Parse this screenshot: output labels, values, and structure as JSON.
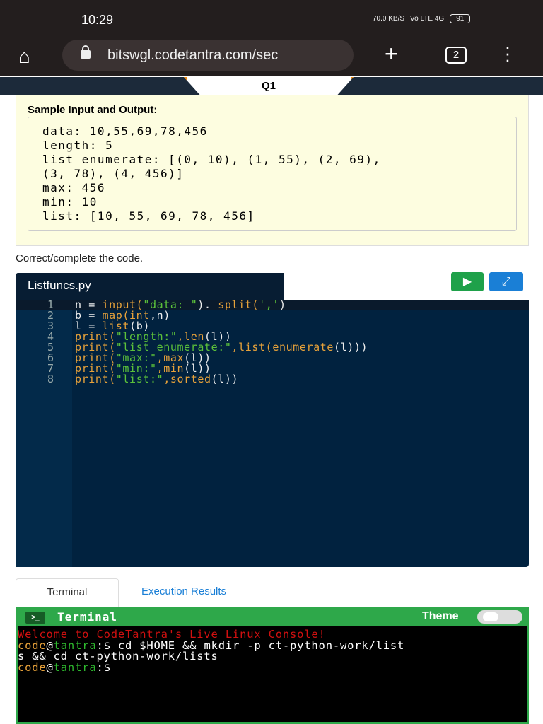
{
  "status": {
    "time": "10:29",
    "speed": "70.0 KB/S",
    "network": "Vo LTE 4G",
    "battery": "91"
  },
  "browser": {
    "url": "bitswgl.codetantra.com/sec",
    "tab_count": "2"
  },
  "question": {
    "label": "Q1"
  },
  "sample": {
    "title": "Sample Input and Output:",
    "lines": [
      "data: 10,55,69,78,456",
      "length: 5",
      "list enumerate: [(0, 10), (1, 55), (2, 69),",
      "(3, 78), (4, 456)]",
      "max: 456",
      "min: 10",
      "list: [10, 55, 69, 78, 456]"
    ]
  },
  "instruction": "Correct/complete the code.",
  "editor": {
    "filename": "Listfuncs.py",
    "run_icon": "▶",
    "expand_icon": "⤢",
    "lines": [
      {
        "n": "1",
        "parts": [
          [
            "",
            "n = "
          ],
          [
            "k",
            "input("
          ],
          [
            "s",
            "\"data: \""
          ],
          [
            "",
            "). "
          ],
          [
            "k",
            "split("
          ],
          [
            "s",
            "','"
          ],
          [
            "",
            ")"
          ]
        ]
      },
      {
        "n": "2",
        "parts": [
          [
            "",
            "b = "
          ],
          [
            "k",
            "map(int"
          ],
          [
            "",
            ",n)"
          ]
        ]
      },
      {
        "n": "3",
        "parts": [
          [
            "",
            "l = "
          ],
          [
            "k",
            "list"
          ],
          [
            "",
            "(b)"
          ]
        ]
      },
      {
        "n": "4",
        "parts": [
          [
            "k",
            "print("
          ],
          [
            "s",
            "\"length:\""
          ],
          [
            "k",
            ",len"
          ],
          [
            "",
            "(l))"
          ]
        ]
      },
      {
        "n": "5",
        "parts": [
          [
            "k",
            "print("
          ],
          [
            "s",
            "\"list enumerate:\""
          ],
          [
            "k",
            ",list(enumerate"
          ],
          [
            "",
            "(l)))"
          ]
        ]
      },
      {
        "n": "6",
        "parts": [
          [
            "k",
            "print("
          ],
          [
            "s",
            "\"max:\""
          ],
          [
            "k",
            ",max"
          ],
          [
            "",
            "(l))"
          ]
        ]
      },
      {
        "n": "7",
        "parts": [
          [
            "k",
            "print("
          ],
          [
            "s",
            "\"min:\""
          ],
          [
            "k",
            ",min"
          ],
          [
            "",
            "(l))"
          ]
        ]
      },
      {
        "n": "8",
        "parts": [
          [
            "k",
            "print("
          ],
          [
            "s",
            "\"list:\""
          ],
          [
            "k",
            ",sorted"
          ],
          [
            "",
            "(l))"
          ]
        ]
      }
    ]
  },
  "tabs": {
    "terminal": "Terminal",
    "results": "Execution Results"
  },
  "terminal": {
    "title": "Terminal",
    "theme_label": "Theme",
    "welcome": "Welcome to CodeTantra's Live Linux Console!",
    "user": "code",
    "host": "tantra",
    "prompt": ":$",
    "command": " cd $HOME && mkdir -p ct-python-work/list",
    "command_cont": "s && cd ct-python-work/lists"
  }
}
